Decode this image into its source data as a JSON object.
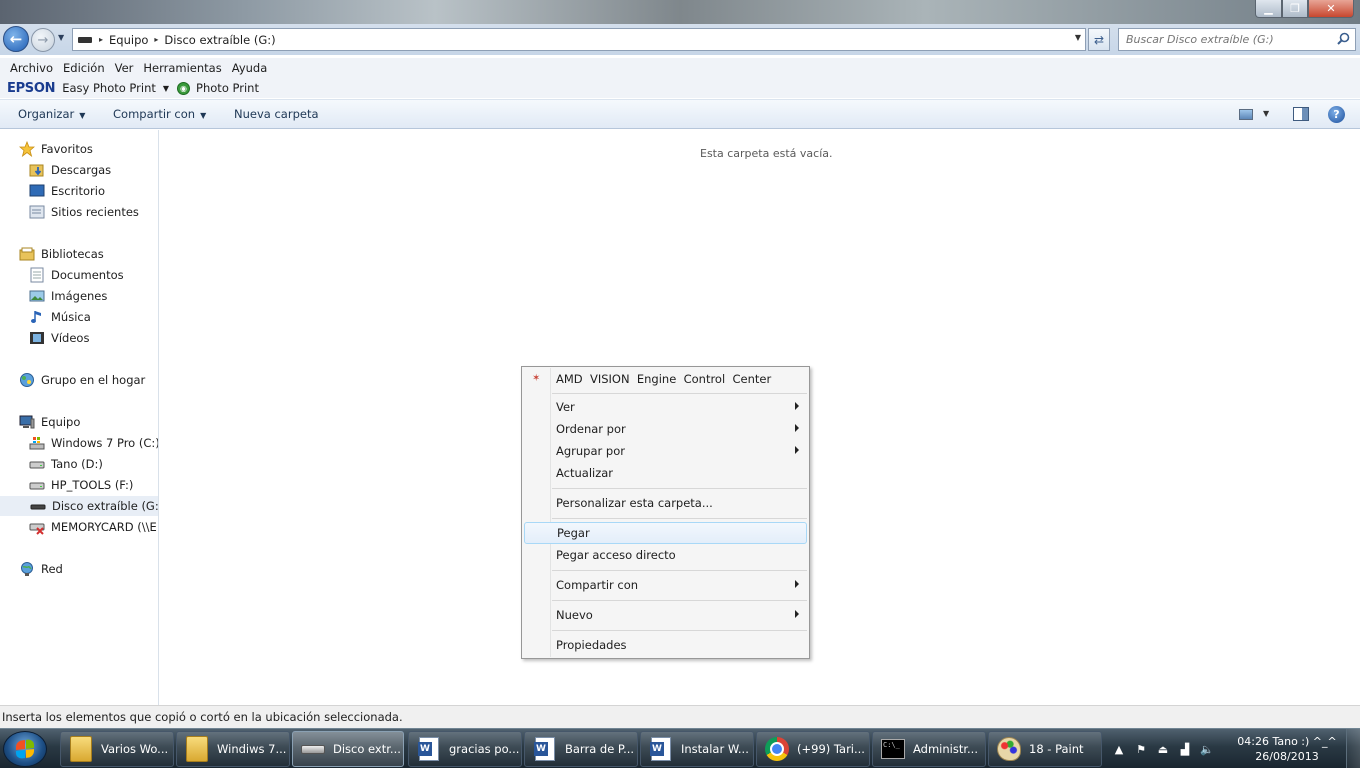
{
  "window": {
    "min_icon": "minimize-icon",
    "max_icon": "maximize-icon",
    "close_icon": "close-icon"
  },
  "address": {
    "crumbs": [
      "Equipo",
      "Disco extraíble (G:)"
    ],
    "search_placeholder": "Buscar Disco extraíble (G:)"
  },
  "menubar": [
    "Archivo",
    "Edición",
    "Ver",
    "Herramientas",
    "Ayuda"
  ],
  "epson": {
    "logo": "EPSON",
    "easy": "Easy Photo Print",
    "photo": "Photo Print"
  },
  "commands": {
    "organize": "Organizar",
    "share": "Compartir con",
    "new_folder": "Nueva carpeta"
  },
  "navpane": {
    "items": [
      {
        "label": "Favoritos",
        "icon": "star-icon"
      },
      {
        "label": "Descargas",
        "icon": "downloads-folder-icon"
      },
      {
        "label": "Escritorio",
        "icon": "desktop-icon"
      },
      {
        "label": "Sitios recientes",
        "icon": "recent-places-icon"
      },
      {
        "label": "Bibliotecas",
        "icon": "libraries-icon"
      },
      {
        "label": "Documentos",
        "icon": "documents-icon"
      },
      {
        "label": "Imágenes",
        "icon": "pictures-icon"
      },
      {
        "label": "Música",
        "icon": "music-icon"
      },
      {
        "label": "Vídeos",
        "icon": "videos-icon"
      },
      {
        "label": "Grupo en el hogar",
        "icon": "homegroup-icon"
      },
      {
        "label": "Equipo",
        "icon": "computer-icon"
      },
      {
        "label": "Windows 7 Pro (C:)",
        "icon": "system-drive-icon"
      },
      {
        "label": "Tano (D:)",
        "icon": "drive-icon"
      },
      {
        "label": "HP_TOOLS (F:)",
        "icon": "drive-icon"
      },
      {
        "label": "Disco extraíble (G:)",
        "icon": "removable-drive-icon"
      },
      {
        "label": "MEMORYCARD (\\\\E",
        "icon": "network-drive-disconnected-icon"
      },
      {
        "label": "Red",
        "icon": "network-icon"
      }
    ]
  },
  "content": {
    "empty_message": "Esta carpeta está vacía."
  },
  "status": "Inserta los elementos que copió o cortó en la ubicación seleccionada.",
  "context_menu": {
    "amd": "AMD  VISION  Engine  Control  Center",
    "ver": "Ver",
    "ordenar": "Ordenar por",
    "agrupar": "Agrupar por",
    "actualizar": "Actualizar",
    "personalizar": "Personalizar esta carpeta...",
    "pegar": "Pegar",
    "pegar_acceso": "Pegar acceso directo",
    "compartir": "Compartir con",
    "nuevo": "Nuevo",
    "propiedades": "Propiedades"
  },
  "taskbar": {
    "items": [
      {
        "label": "Varios Wo...",
        "icon": "folder-icon"
      },
      {
        "label": "Windiws 7...",
        "icon": "folder-icon"
      },
      {
        "label": "Disco extr...",
        "icon": "removable-drive-icon"
      },
      {
        "label": "gracias po...",
        "icon": "word-icon"
      },
      {
        "label": "Barra de P...",
        "icon": "word-icon"
      },
      {
        "label": "Instalar W...",
        "icon": "word-icon"
      },
      {
        "label": "(+99) Tari...",
        "icon": "chrome-icon"
      },
      {
        "label": "Administr...",
        "icon": "cmd-icon"
      },
      {
        "label": "18 - Paint",
        "icon": "paint-icon"
      }
    ],
    "clock_line1": "04:26 Tano :)  ^_^",
    "clock_line2": "26/08/2013"
  },
  "colors": {
    "epson_blue": "#1a3c8f",
    "menu_hover_border": "#a8d8f7"
  }
}
